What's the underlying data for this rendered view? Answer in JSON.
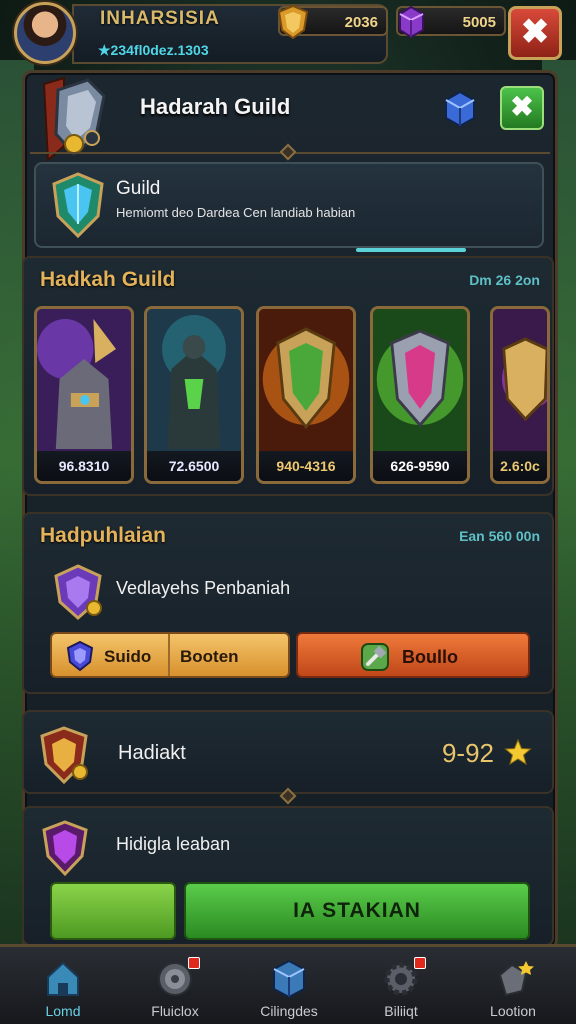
{
  "player": {
    "name": "INHARSISIA",
    "id": "★234fl0dez.1303"
  },
  "resources": {
    "gold": "2036",
    "gems": "5005"
  },
  "header": {
    "title": "Hadarah Guild",
    "close_label": "✖",
    "header_close_label": "✖"
  },
  "guild_info": {
    "title": "Guild",
    "description": "Hemiomt deo Dardea Cen landiab habian"
  },
  "cards_section": {
    "title": "Hadkah Guild",
    "meta": "Dm 26 2on",
    "cards": [
      {
        "value": "96.8310",
        "color": "#e8e8ff"
      },
      {
        "value": "72.6500",
        "color": "#e8e8ff"
      },
      {
        "value": "940-4316",
        "color": "#f0c870"
      },
      {
        "value": "626-9590",
        "color": "#ffffff"
      },
      {
        "value": "2.6:0c",
        "color": "#e8c870"
      }
    ]
  },
  "rewards_section": {
    "title": "Hadpuhlaian",
    "meta": "Ean 560 00n",
    "row_text": "Vedlayehs Penbaniah",
    "split_left": "Suido",
    "split_right": "Booten",
    "orange_button": "Boullo"
  },
  "rank": {
    "label": "Hadiakt",
    "score": "9-92"
  },
  "claim": {
    "text": "Hidigla leaban",
    "button": "IA STAKIAN"
  },
  "nav": [
    {
      "label": "Lomd",
      "active": true
    },
    {
      "label": "Fluiclox"
    },
    {
      "label": "Cilingdes"
    },
    {
      "label": "Biliiqt"
    },
    {
      "label": "Lootion"
    }
  ],
  "colors": {
    "gold_accent": "#e3b25a",
    "teal_accent": "#5ec0c6",
    "green_button": "#3aa82e",
    "orange_button": "#d85a24",
    "close_red": "#c8361e"
  }
}
